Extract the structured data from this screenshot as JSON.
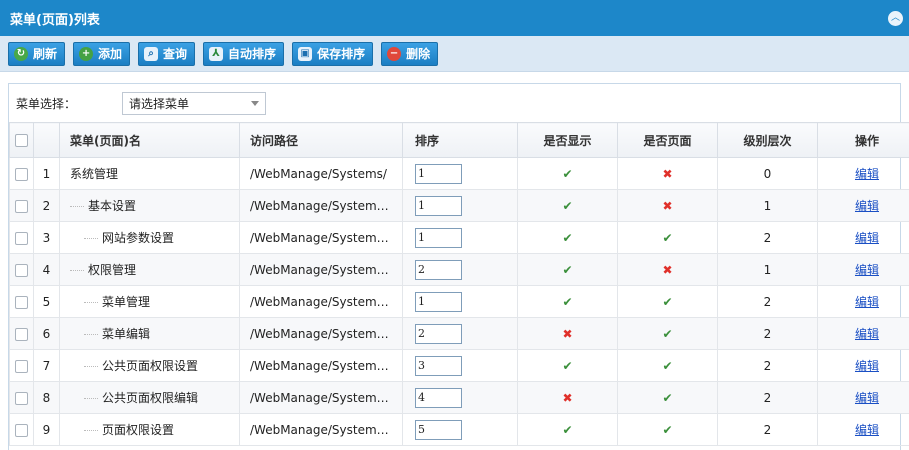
{
  "title": "菜单(页面)列表",
  "toolbar": {
    "refresh": "刷新",
    "add": "添加",
    "query": "查询",
    "auto_sort": "自动排序",
    "save_sort": "保存排序",
    "delete": "删除"
  },
  "filter": {
    "label": "菜单选择：",
    "select_value": "请选择菜单"
  },
  "table": {
    "headers": {
      "rownum": "",
      "name": "菜单(页面)名",
      "path": "访问路径",
      "sort": "排序",
      "show": "是否显示",
      "is_page": "是否页面",
      "level": "级别层次",
      "action": "操作"
    },
    "rows": [
      {
        "no": "1",
        "name": "系统管理",
        "depth": 0,
        "path": "/WebManage/Systems/",
        "sort": "1",
        "show": "yes",
        "is_page": "no",
        "level": "0",
        "action": "编辑"
      },
      {
        "no": "2",
        "name": "基本设置",
        "depth": 1,
        "path": "/WebManage/System…",
        "sort": "1",
        "show": "yes",
        "is_page": "no",
        "level": "1",
        "action": "编辑"
      },
      {
        "no": "3",
        "name": "网站参数设置",
        "depth": 2,
        "path": "/WebManage/System…",
        "sort": "1",
        "show": "yes",
        "is_page": "yes",
        "level": "2",
        "action": "编辑"
      },
      {
        "no": "4",
        "name": "权限管理",
        "depth": 1,
        "path": "/WebManage/System…",
        "sort": "2",
        "show": "yes",
        "is_page": "no",
        "level": "1",
        "action": "编辑"
      },
      {
        "no": "5",
        "name": "菜单管理",
        "depth": 2,
        "path": "/WebManage/System…",
        "sort": "1",
        "show": "yes",
        "is_page": "yes",
        "level": "2",
        "action": "编辑"
      },
      {
        "no": "6",
        "name": "菜单编辑",
        "depth": 2,
        "path": "/WebManage/System…",
        "sort": "2",
        "show": "no",
        "is_page": "yes",
        "level": "2",
        "action": "编辑"
      },
      {
        "no": "7",
        "name": "公共页面权限设置",
        "depth": 2,
        "path": "/WebManage/System…",
        "sort": "3",
        "show": "yes",
        "is_page": "yes",
        "level": "2",
        "action": "编辑"
      },
      {
        "no": "8",
        "name": "公共页面权限编辑",
        "depth": 2,
        "path": "/WebManage/System…",
        "sort": "4",
        "show": "no",
        "is_page": "yes",
        "level": "2",
        "action": "编辑"
      },
      {
        "no": "9",
        "name": "页面权限设置",
        "depth": 2,
        "path": "/WebManage/System…",
        "sort": "5",
        "show": "yes",
        "is_page": "yes",
        "level": "2",
        "action": "编辑"
      }
    ]
  },
  "icons": {
    "check": "check-icon",
    "cross": "cross-icon",
    "collapse": "collapse-up-icon"
  },
  "colors": {
    "title_bar": "#1d87c9",
    "button": "#1b7ec3",
    "check": "#3a8f3a",
    "cross": "#e0302a",
    "link": "#1a4fc4"
  }
}
